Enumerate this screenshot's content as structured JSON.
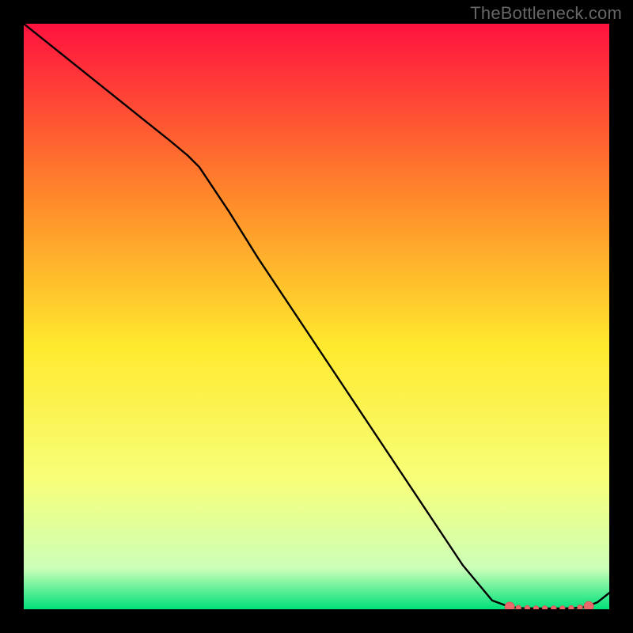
{
  "watermark": "TheBottleneck.com",
  "colors": {
    "frame": "#000000",
    "gradient_top": "#ff123f",
    "gradient_upper_mid": "#ff8a2a",
    "gradient_mid": "#ffe92e",
    "gradient_lower_mid": "#f7ff7a",
    "gradient_near_bottom": "#ccffb8",
    "gradient_bottom": "#00e17a",
    "line": "#000000",
    "marker_fill": "#e96a6a",
    "marker_stroke": "#d95858"
  },
  "chart_data": {
    "type": "line",
    "title": "",
    "xlabel": "",
    "ylabel": "",
    "xlim": [
      0,
      100
    ],
    "ylim": [
      0,
      100
    ],
    "series": [
      {
        "name": "curve",
        "x": [
          0,
          5,
          10,
          15,
          20,
          25,
          28,
          30,
          35,
          40,
          45,
          50,
          55,
          60,
          65,
          70,
          75,
          80,
          83,
          85,
          88,
          90,
          92,
          94,
          96,
          98,
          100
        ],
        "y": [
          100,
          96,
          92,
          88,
          84,
          80,
          77.5,
          75.5,
          68,
          60,
          52.5,
          45,
          37.5,
          30,
          22.5,
          15,
          7.5,
          1.5,
          0.4,
          0.2,
          0.15,
          0.15,
          0.15,
          0.2,
          0.4,
          1.2,
          2.8
        ]
      }
    ],
    "markers": {
      "name": "baseline-cluster",
      "points": [
        {
          "x": 83,
          "y": 0.4
        },
        {
          "x": 84.5,
          "y": 0.25
        },
        {
          "x": 86,
          "y": 0.2
        },
        {
          "x": 87.5,
          "y": 0.15
        },
        {
          "x": 89,
          "y": 0.15
        },
        {
          "x": 90.5,
          "y": 0.15
        },
        {
          "x": 92,
          "y": 0.15
        },
        {
          "x": 93.5,
          "y": 0.2
        },
        {
          "x": 95,
          "y": 0.3
        },
        {
          "x": 96.5,
          "y": 0.5
        }
      ],
      "large_radius_indices": [
        0,
        9
      ]
    }
  }
}
